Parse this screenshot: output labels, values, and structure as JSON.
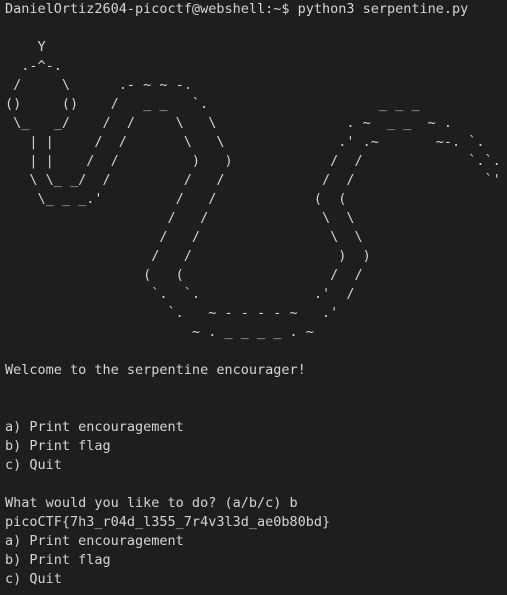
{
  "prompt_line": "DanielOrtiz2604-picoctf@webshell:~$ python3 serpentine.py",
  "ascii_art": [
    "",
    "    Y",
    "  .-^-.",
    " /     \\      .- ~ ~ -.",
    "()     ()    /   _ _   `.                     _ _ _",
    " \\_   _/    /  /     \\   \\                . ~  _ _  ~ .",
    "   | |     /  /       \\   \\              .' .~       ~-. `.",
    "   | |    /  /         )   )            /  /             `.`.",
    "   \\ \\_ _/  /         /   /            /  /                `'",
    "    \\_ _ _.'         /   /            (  (",
    "                    /   /              \\  \\",
    "                   /   /                \\  \\",
    "                  /   /                  )  )",
    "                 (   (                  /  /",
    "                  `.  `.              .'  /",
    "                    `.   ~ - - - - ~   .'",
    "                       ~ . _ _ _ _ . ~"
  ],
  "welcome": "Welcome to the serpentine encourager!",
  "menu_first": [
    "a) Print encouragement",
    "b) Print flag",
    "c) Quit"
  ],
  "question": "What would you like to do? (a/b/c) b",
  "flag": "picoCTF{7h3_r04d_l355_7r4v3l3d_ae0b80bd}",
  "menu_second": [
    "a) Print encouragement",
    "b) Print flag",
    "c) Quit"
  ]
}
